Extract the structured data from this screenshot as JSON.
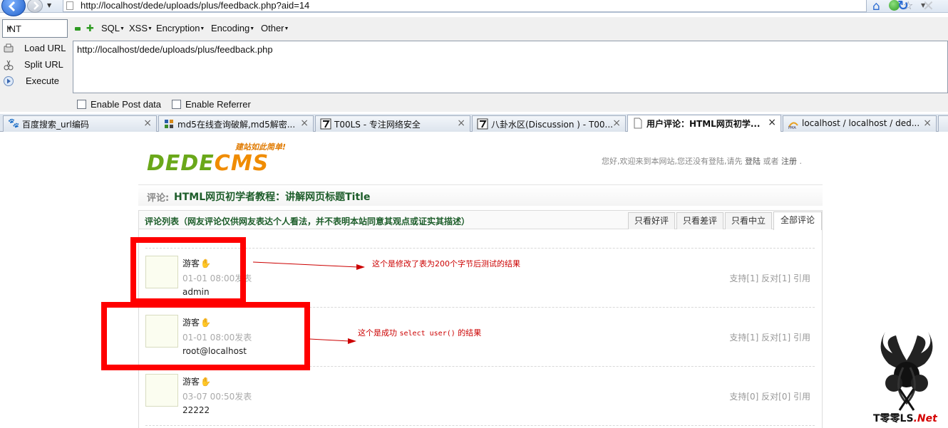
{
  "browser": {
    "address": "http://localhost/dede/uploads/plus/feedback.php?aid=14"
  },
  "hackbar": {
    "type_select": "INT",
    "menus": [
      "SQL",
      "XSS",
      "Encryption",
      "Encoding",
      "Other"
    ],
    "actions": [
      "Load URL",
      "Split URL",
      "Execute"
    ],
    "url_value": "http://localhost/dede/uploads/plus/feedback.php",
    "enable_post": "Enable Post data",
    "enable_referrer": "Enable Referrer"
  },
  "tabs": [
    {
      "title": "百度搜索_url编码",
      "icon": "paw-icon"
    },
    {
      "title": "md5在线查询破解,md5解密...",
      "icon": "grid-icon"
    },
    {
      "title": "T00LS - 专注网络安全",
      "icon": "seven-icon"
    },
    {
      "title": "八卦水区(Discussion ) - T00...",
      "icon": "seven-icon"
    },
    {
      "title": "用户评论：HTML网页初学...",
      "icon": "page-icon",
      "active": true
    },
    {
      "title": "localhost / localhost / ded...",
      "icon": "pma-icon"
    }
  ],
  "page": {
    "logo_text_1": "DEDE",
    "logo_text_2": "CMS",
    "logo_slogan": "建站如此简单!",
    "welcome_pre": "您好,欢迎来到本网站,您还没有登陆,请先 ",
    "login_link": "登陆",
    "welcome_mid": " 或者 ",
    "register_link": "注册",
    "welcome_end": " .",
    "title_label": "评论:",
    "article_title": "HTML网页初学者教程：讲解网页标题Title",
    "list_caption": "评论列表（网友评论仅供网友表达个人看法，并不表明本站同意其观点或证实其描述）",
    "filters": [
      "只看好评",
      "只看差评",
      "只看中立",
      "全部评论"
    ],
    "comments": [
      {
        "user": "游客",
        "time": "01-01 08:00发表",
        "msg": "admin",
        "actions": "支持[1] 反对[1] 引用"
      },
      {
        "user": "游客",
        "time": "01-01 08:00发表",
        "msg": "root@localhost",
        "actions": "支持[1] 反对[1] 引用"
      },
      {
        "user": "游客",
        "time": "03-07 00:50发表",
        "msg": "22222",
        "actions": "支持[0] 反对[0] 引用"
      }
    ]
  },
  "annotations": {
    "note1": "这个是修改了表为200个字节后测试的结果",
    "note2_pre": "这个是成功 ",
    "note2_code": "select user()",
    "note2_post": " 的结果"
  },
  "watermark": {
    "text_pre": "T零零LS",
    "text_net": ".Net"
  },
  "colors": {
    "accent_red": "#ff0000",
    "logo_green": "#6aa81a",
    "logo_orange": "#f08c00",
    "title_green": "#1d5d2a"
  }
}
